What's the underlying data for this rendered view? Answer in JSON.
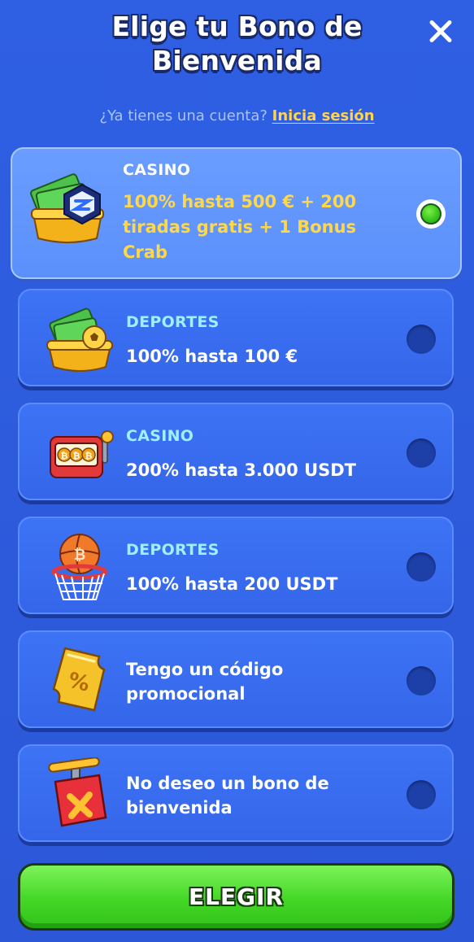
{
  "header": {
    "title": "Elige tu Bono de Bienvenida",
    "login_prompt": "¿Ya tienes una cuenta?",
    "login_link": "Inicia sesión"
  },
  "options": [
    {
      "category": "CASINO",
      "offer": "100% hasta 500 € + 200 tiradas gratis + 1 Bonus Crab",
      "icon": "cash-crypto-icon",
      "selected": true
    },
    {
      "category": "DEPORTES",
      "offer": "100% hasta 100 €",
      "icon": "cash-football-icon",
      "selected": false
    },
    {
      "category": "CASINO",
      "offer": "200% hasta 3.000 USDT",
      "icon": "slot-machine-icon",
      "selected": false
    },
    {
      "category": "DEPORTES",
      "offer": "100% hasta 200 USDT",
      "icon": "basketball-hoop-icon",
      "selected": false
    },
    {
      "category": "",
      "offer": "Tengo un código promocional",
      "icon": "promo-ticket-icon",
      "selected": false
    },
    {
      "category": "",
      "offer": "No deseo un bono de bienvenida",
      "icon": "no-bonus-box-icon",
      "selected": false
    }
  ],
  "actions": {
    "choose_label": "ELEGIR"
  },
  "colors": {
    "background": "#2f5ee0",
    "card": "#3566ea",
    "card_selected": "#5b90fb",
    "category_text": "#9ef0ff",
    "highlight_text": "#ffd84a",
    "button": "#43d726"
  }
}
